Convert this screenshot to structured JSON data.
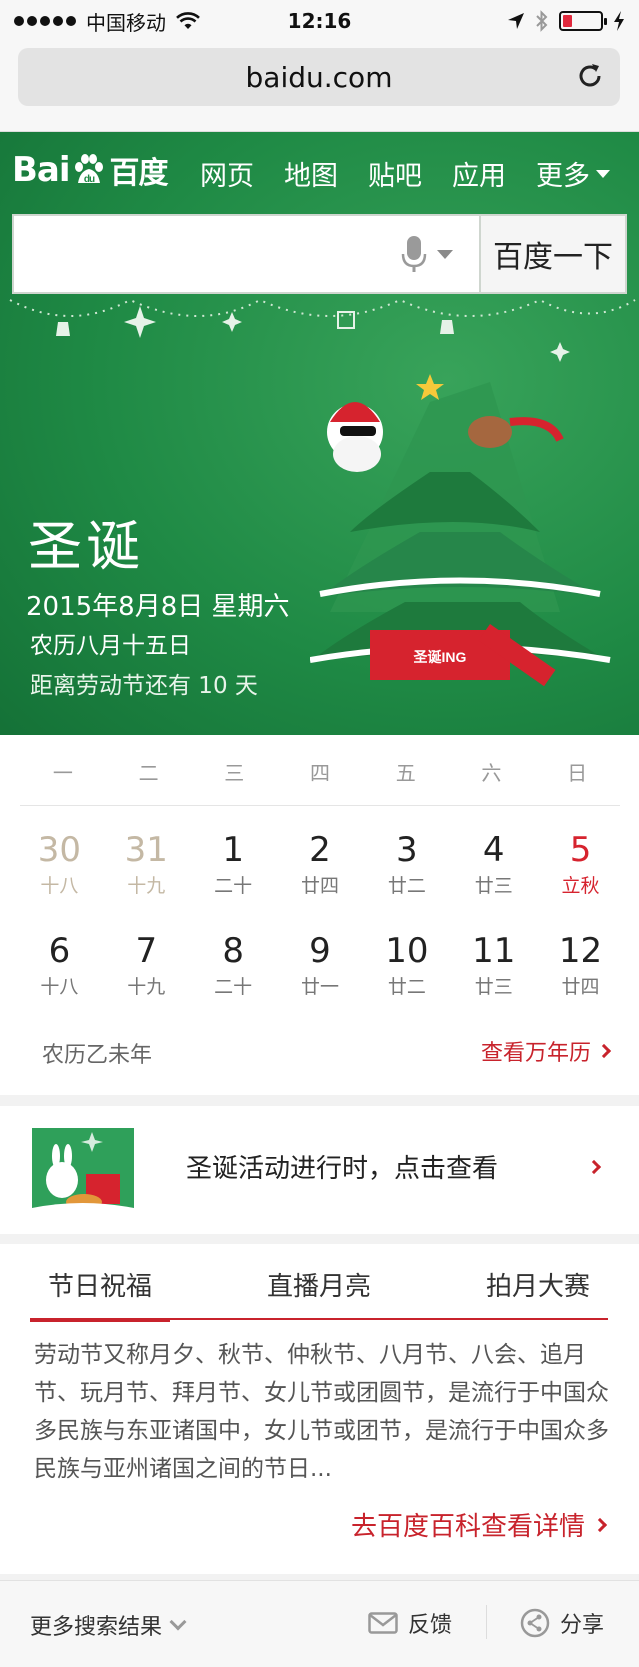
{
  "status_bar": {
    "carrier": "中国移动",
    "time": "12:16",
    "battery_level": 0.25
  },
  "browser": {
    "url": "baidu.com"
  },
  "header": {
    "logo_text_latin_1": "Bai",
    "logo_text_latin_2": "du",
    "logo_text_cn": "百度",
    "nav": [
      "网页",
      "地图",
      "贴吧",
      "应用"
    ],
    "nav_more": "更多",
    "search_placeholder": "",
    "search_button": "百度一下"
  },
  "hero": {
    "title": "圣诞",
    "date": "2015年8月8日 星期六",
    "lunar": "农历八月十五日",
    "countdown": "距离劳动节还有 10 天",
    "gift_box_text": "圣诞ING",
    "colors": {
      "green": "#1f8a45",
      "red": "#d6232e"
    }
  },
  "calendar": {
    "weekdays": [
      "一",
      "二",
      "三",
      "四",
      "五",
      "六",
      "日"
    ],
    "days": [
      {
        "num": "30",
        "lunar": "十八",
        "style": "dim"
      },
      {
        "num": "31",
        "lunar": "十九",
        "style": "dim"
      },
      {
        "num": "1",
        "lunar": "二十",
        "style": ""
      },
      {
        "num": "2",
        "lunar": "廿四",
        "style": ""
      },
      {
        "num": "3",
        "lunar": "廿二",
        "style": ""
      },
      {
        "num": "4",
        "lunar": "廿三",
        "style": ""
      },
      {
        "num": "5",
        "lunar": "立秋",
        "style": "red"
      },
      {
        "num": "6",
        "lunar": "十八",
        "style": ""
      },
      {
        "num": "7",
        "lunar": "十九",
        "style": ""
      },
      {
        "num": "8",
        "lunar": "二十",
        "style": ""
      },
      {
        "num": "9",
        "lunar": "廿一",
        "style": ""
      },
      {
        "num": "10",
        "lunar": "廿二",
        "style": ""
      },
      {
        "num": "11",
        "lunar": "廿三",
        "style": ""
      },
      {
        "num": "12",
        "lunar": "廿四",
        "style": ""
      }
    ],
    "footer_left": "农历乙未年",
    "footer_link": "查看万年历"
  },
  "promo": {
    "text": "圣诞活动进行时，点击查看"
  },
  "info": {
    "tabs": [
      "节日祝福",
      "直播月亮",
      "拍月大赛"
    ],
    "body": "劳动节又称月夕、秋节、仲秋节、八月节、八会、追月节、玩月节、拜月节、女儿节或团圆节，是流行于中国众多民族与东亚诸国中，女儿节或团节，是流行于中国众多民族与亚州诸国之间的节日...",
    "link": "去百度百科查看详情"
  },
  "bottom_bar": {
    "more": "更多搜索结果",
    "feedback": "反馈",
    "share": "分享"
  }
}
